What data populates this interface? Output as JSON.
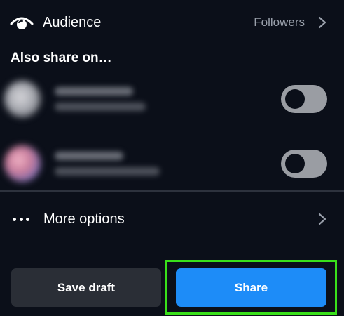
{
  "audience": {
    "icon": "eye-icon",
    "label": "Audience",
    "value": "Followers"
  },
  "also_share": {
    "title": "Also share on…",
    "accounts": [
      {
        "toggle_on": false
      },
      {
        "toggle_on": false
      }
    ]
  },
  "more_options": {
    "icon": "more-dots-icon",
    "label": "More options"
  },
  "buttons": {
    "save_draft": "Save draft",
    "share": "Share"
  },
  "colors": {
    "background": "#0b0f19",
    "share_blue": "#1d8cf8",
    "secondary_button": "#2a2e36",
    "toggle_off": "#9a9da3",
    "highlight_green": "#39e01a"
  }
}
